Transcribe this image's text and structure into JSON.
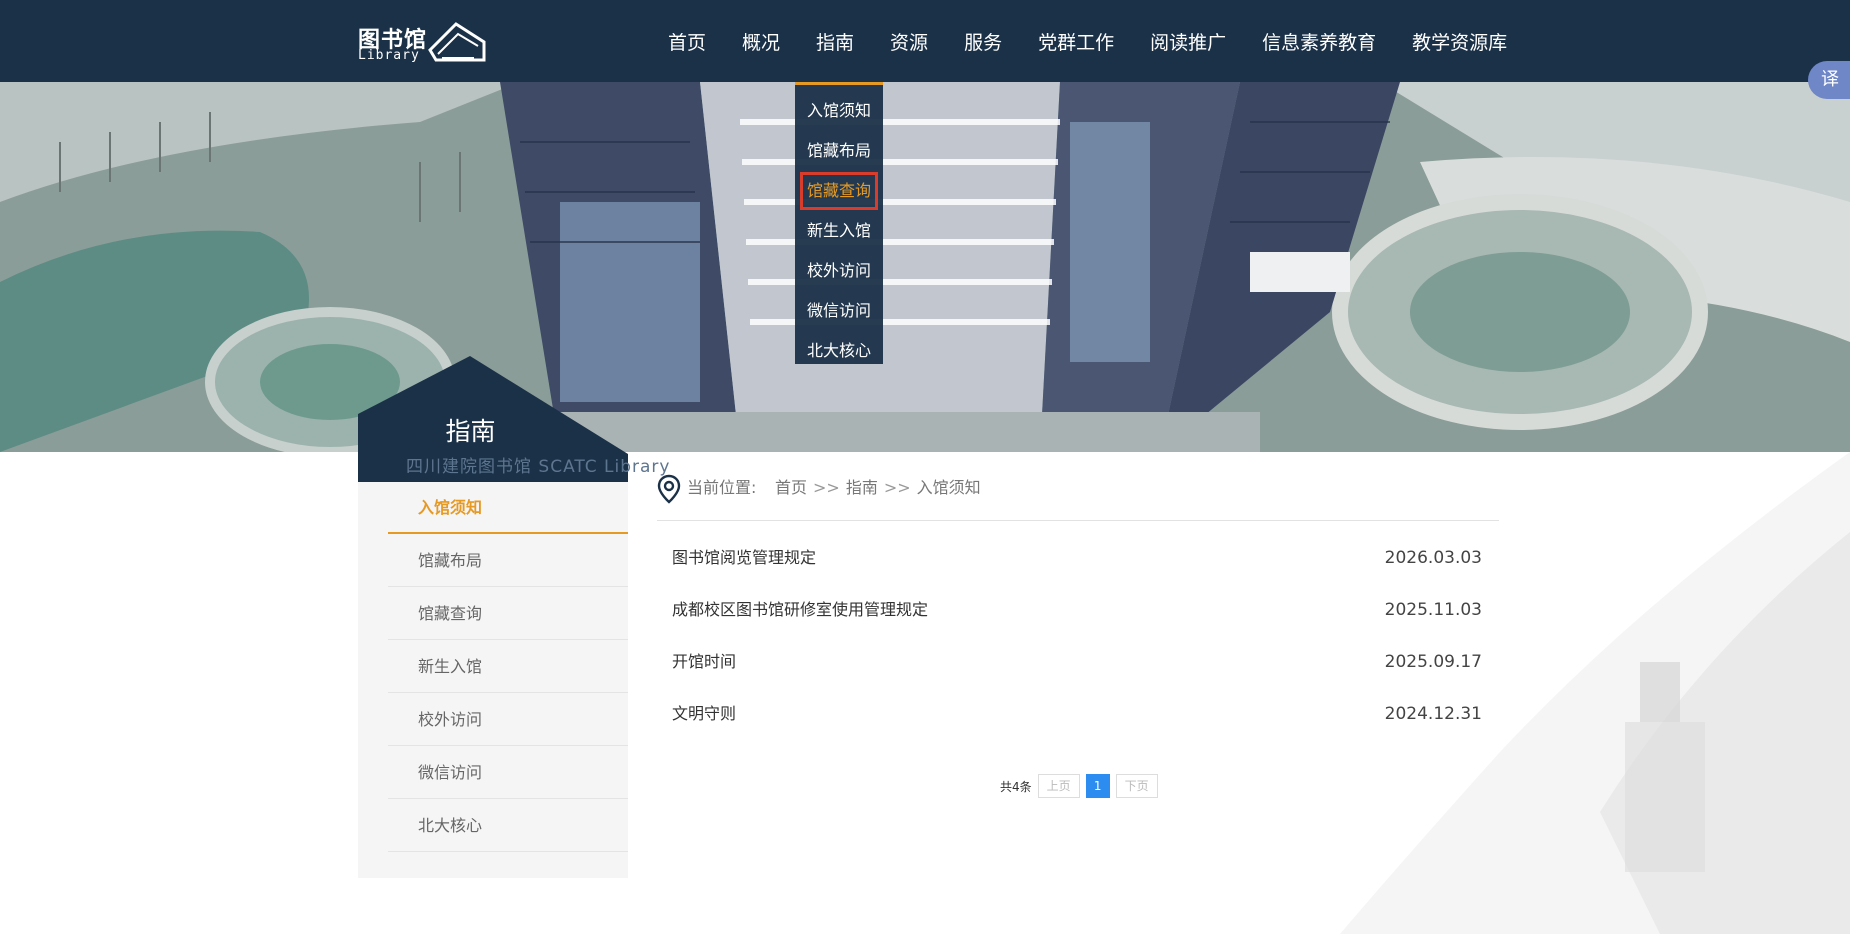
{
  "header": {
    "logo_cn": "图书馆",
    "logo_en": "Library",
    "nav": [
      "首页",
      "概况",
      "指南",
      "资源",
      "服务",
      "党群工作",
      "阅读推广",
      "信息素养教育",
      "教学资源库"
    ],
    "translate_label": "译"
  },
  "dropdown": {
    "items": [
      "入馆须知",
      "馆藏布局",
      "馆藏查询",
      "新生入馆",
      "校外访问",
      "微信访问",
      "北大核心"
    ]
  },
  "sidebar": {
    "title": "指南",
    "subtitle": "四川建院图书馆  SCATC Library",
    "items": [
      "入馆须知",
      "馆藏布局",
      "馆藏查询",
      "新生入馆",
      "校外访问",
      "微信访问",
      "北大核心"
    ]
  },
  "breadcrumb": {
    "label": "当前位置:",
    "home": "首页",
    "sep": ">>",
    "section": "指南",
    "current": "入馆须知"
  },
  "articles": [
    {
      "title": "图书馆阅览管理规定",
      "date": "2026.03.03"
    },
    {
      "title": "成都校区图书馆研修室使用管理规定",
      "date": "2025.11.03"
    },
    {
      "title": "开馆时间",
      "date": "2025.09.17"
    },
    {
      "title": "文明守则",
      "date": "2024.12.31"
    }
  ],
  "pagination": {
    "total": "共4条",
    "prev": "上页",
    "current": "1",
    "next": "下页"
  },
  "colors": {
    "header_bg": "#1b3148",
    "accent": "#e69a24",
    "highlight_border": "#d93c2b",
    "pager_active": "#2d8cf0"
  }
}
